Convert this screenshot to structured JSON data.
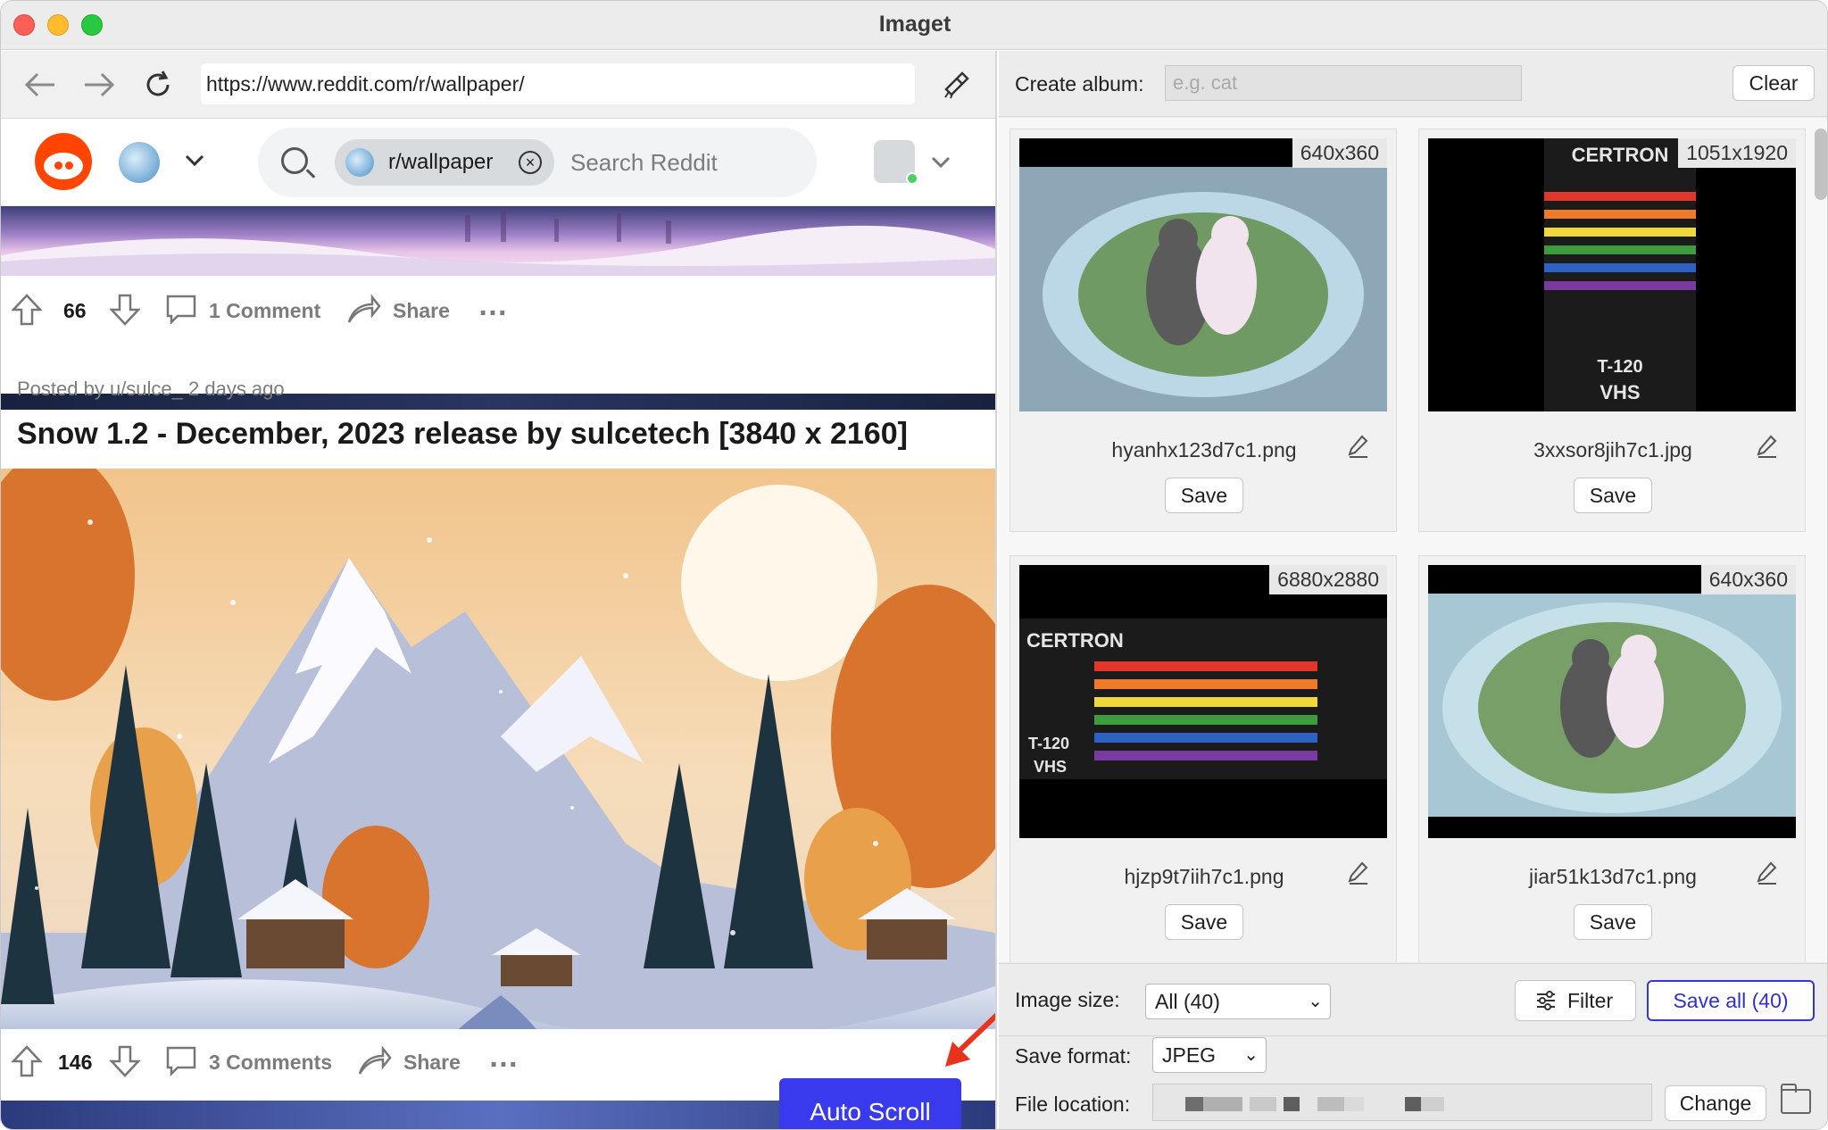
{
  "window": {
    "title": "Imaget"
  },
  "browser": {
    "url": "https://www.reddit.com/r/wallpaper/",
    "subreddit_chip": "r/wallpaper",
    "search_placeholder": "Search Reddit"
  },
  "feed": {
    "post1": {
      "votes": "66",
      "comments": "1 Comment",
      "share": "Share",
      "more": "…"
    },
    "post2": {
      "meta": "Posted by u/sulce_ 2 days ago",
      "title": "Snow 1.2 - December, 2023 release by sulcetech [3840 x 2160]",
      "votes": "146",
      "comments": "3 Comments",
      "share": "Share",
      "more": "…"
    },
    "auto_scroll": "Auto Scroll"
  },
  "panel": {
    "create_album_label": "Create album:",
    "album_placeholder": "e.g. cat",
    "clear": "Clear",
    "images": [
      {
        "dim": "640x360",
        "name": "hyanhx123d7c1.png",
        "save": "Save"
      },
      {
        "dim": "1051x1920",
        "name": "3xxsor8jih7c1.jpg",
        "save": "Save"
      },
      {
        "dim": "6880x2880",
        "name": "hjzp9t7iih7c1.png",
        "save": "Save"
      },
      {
        "dim": "640x360",
        "name": "jiar51k13d7c1.png",
        "save": "Save"
      }
    ],
    "image_size_label": "Image size:",
    "image_size_value": "All (40)",
    "filter": "Filter",
    "save_all": "Save all (40)",
    "save_format_label": "Save format:",
    "save_format_value": "JPEG",
    "file_location_label": "File location:",
    "change": "Change"
  },
  "colors": {
    "reddit_orange": "#ff4500",
    "auto_scroll": "#3939ee",
    "save_all": "#3030d0"
  },
  "icons": [
    "back-arrow-icon",
    "forward-arrow-icon",
    "reload-icon",
    "broom-icon",
    "search-icon",
    "upvote-icon",
    "downvote-icon",
    "comment-icon",
    "share-icon",
    "pencil-icon",
    "filter-icon",
    "folder-icon"
  ]
}
